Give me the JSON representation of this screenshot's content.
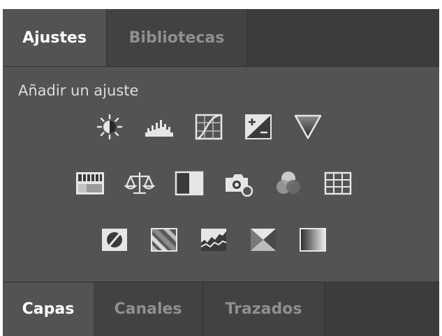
{
  "top_tabs": [
    {
      "label": "Ajustes",
      "active": true
    },
    {
      "label": "Bibliotecas",
      "active": false
    }
  ],
  "adjustments": {
    "heading": "Añadir un ajuste",
    "icons": [
      "brightness-contrast-icon",
      "levels-icon",
      "curves-icon",
      "exposure-icon",
      "vibrance-icon",
      "hue-saturation-icon",
      "color-balance-icon",
      "black-white-icon",
      "photo-filter-icon",
      "channel-mixer-icon",
      "color-lookup-icon",
      "invert-icon",
      "posterize-icon",
      "threshold-icon",
      "selective-color-icon",
      "gradient-map-icon"
    ]
  },
  "bottom_tabs": [
    {
      "label": "Capas",
      "active": true
    },
    {
      "label": "Canales",
      "active": false
    },
    {
      "label": "Trazados",
      "active": false
    }
  ],
  "colors": {
    "panel_bg": "#535353",
    "tabbar_bg": "#3c3c3c",
    "icon_light": "#e6e6e6",
    "icon_dark": "#3a3a3a"
  }
}
